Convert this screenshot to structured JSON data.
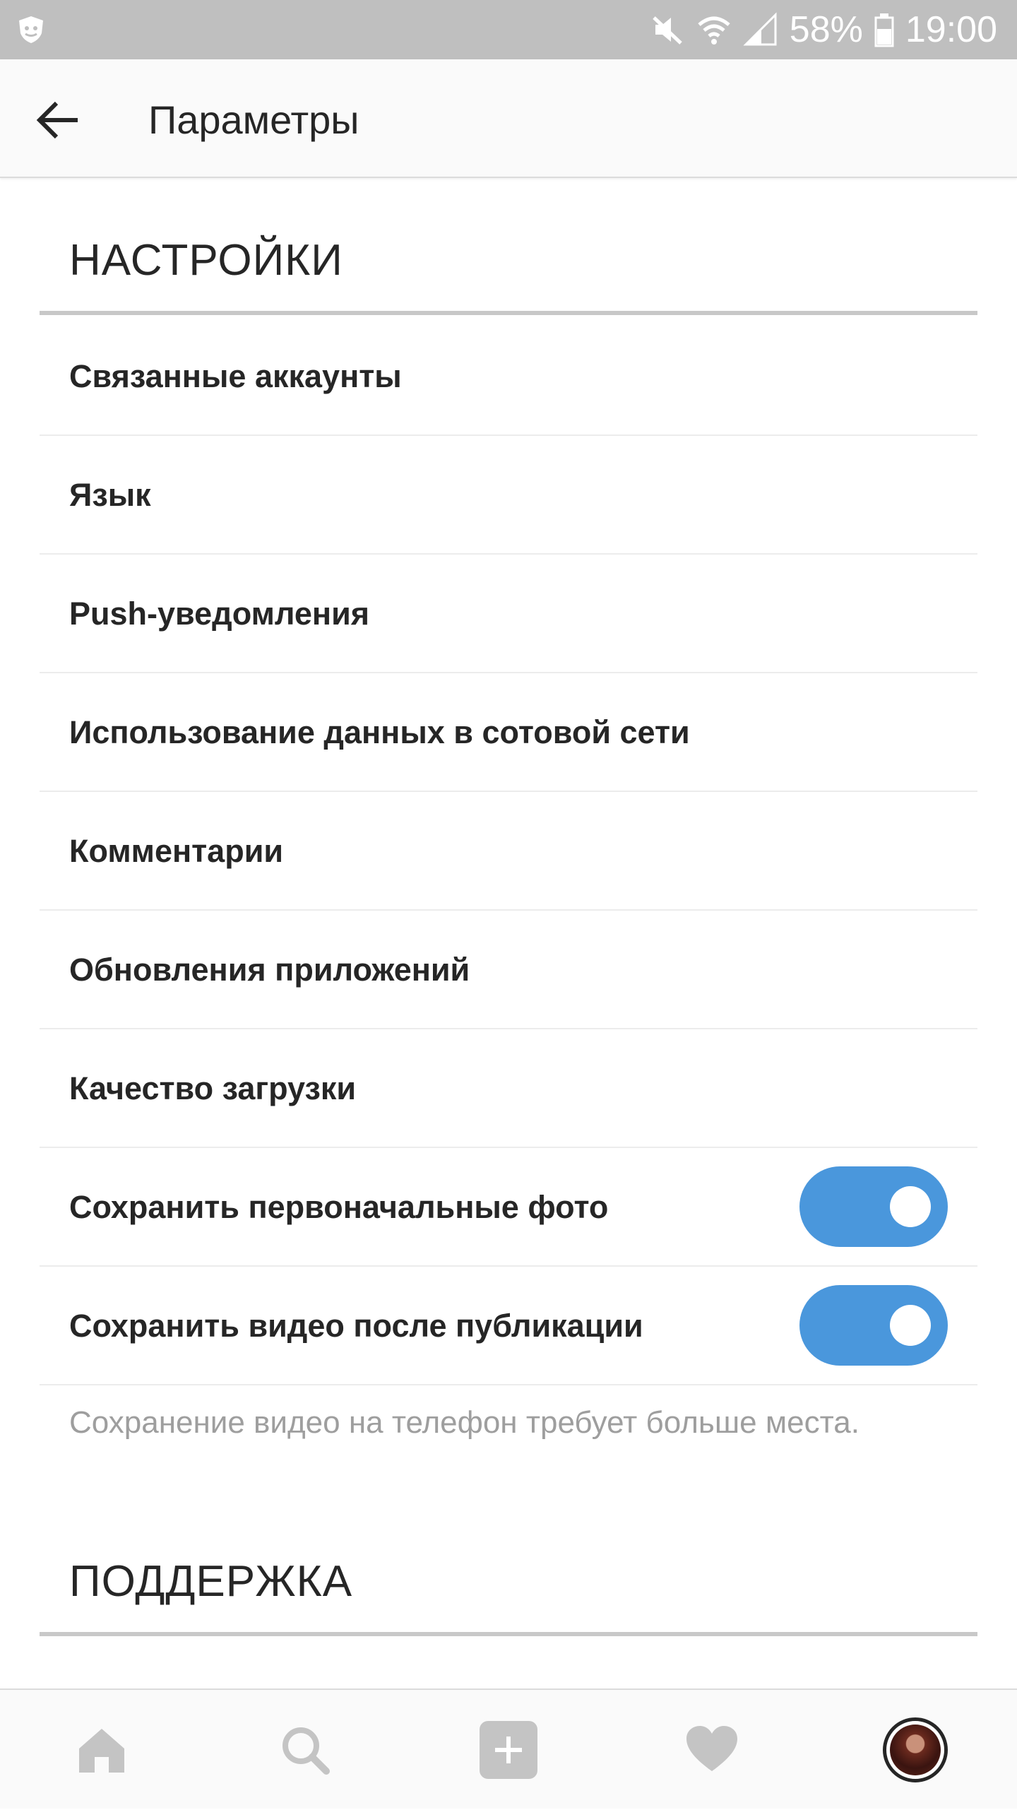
{
  "status_bar": {
    "battery": "58%",
    "time": "19:00",
    "icons": [
      "shield-icon",
      "mute-icon",
      "wifi-icon",
      "signal-icon",
      "battery-icon"
    ]
  },
  "app_bar": {
    "title": "Параметры",
    "back_icon": "arrow-left-icon"
  },
  "settings": {
    "header": "НАСТРОЙКИ",
    "items": [
      {
        "label": "Связанные аккаунты"
      },
      {
        "label": "Язык"
      },
      {
        "label": "Push-уведомления"
      },
      {
        "label": "Использование данных в сотовой сети"
      },
      {
        "label": "Комментарии"
      },
      {
        "label": "Обновления приложений"
      },
      {
        "label": "Качество загрузки"
      },
      {
        "label": "Сохранить первоначальные фото",
        "toggle": true
      },
      {
        "label": "Сохранить видео после публикации",
        "toggle": true
      }
    ],
    "note": "Сохранение видео на телефон требует больше места."
  },
  "support": {
    "header": "ПОДДЕРЖКА"
  },
  "bottom_nav": {
    "items": [
      "home-icon",
      "search-icon",
      "add-post-icon",
      "heart-icon",
      "profile-avatar"
    ]
  },
  "colors": {
    "accent": "#4a97dc",
    "status_bar": "#bfbfbf",
    "text": "#262626",
    "muted": "#9e9e9e"
  }
}
